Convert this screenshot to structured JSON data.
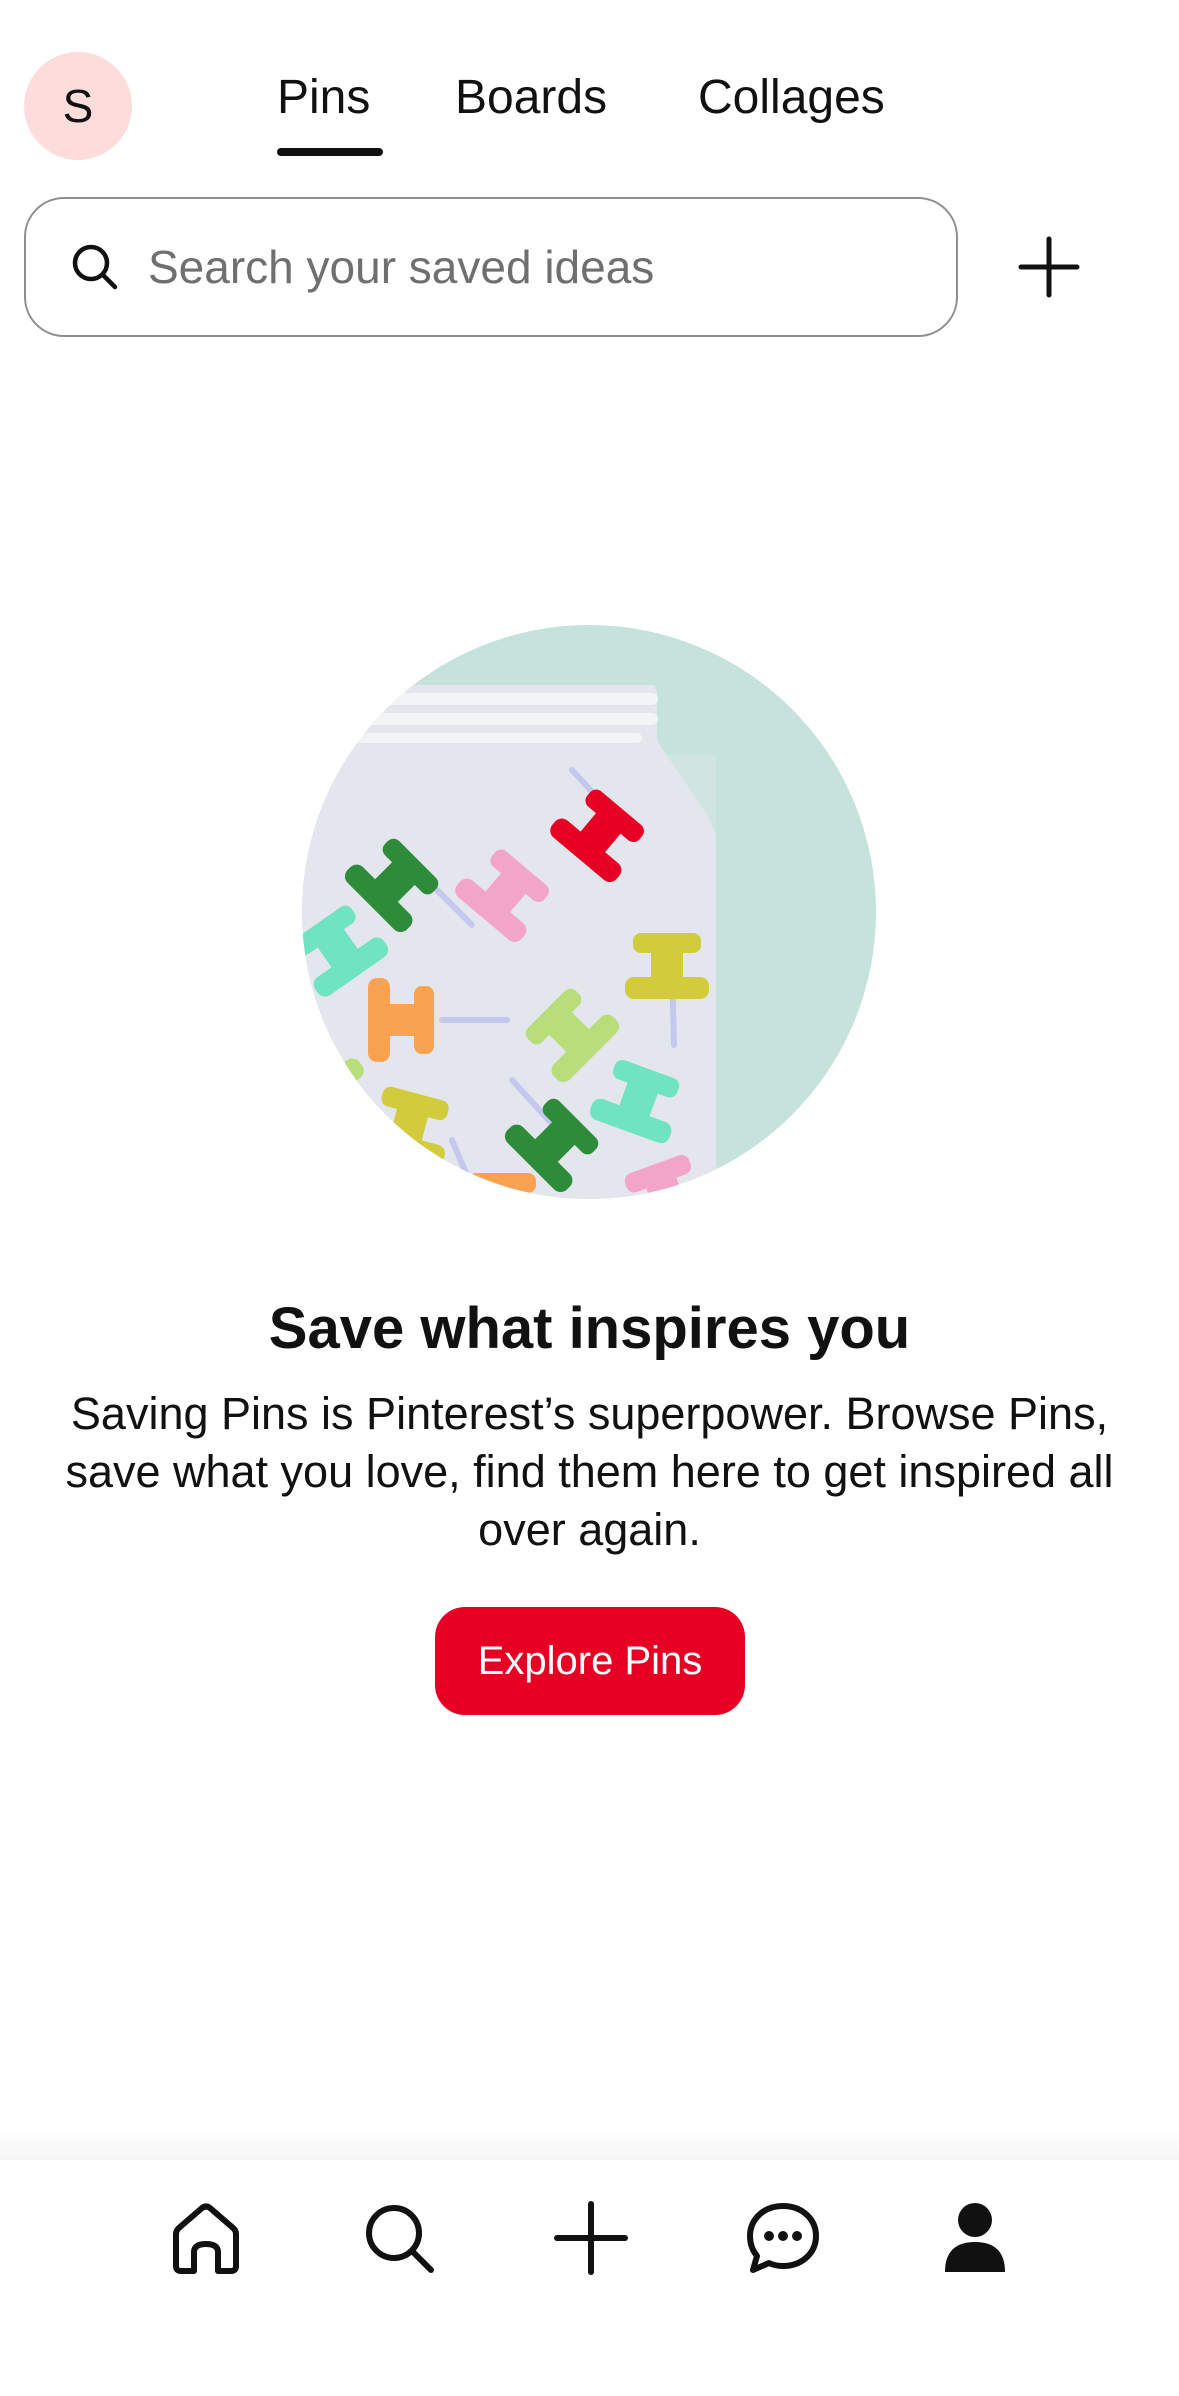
{
  "header": {
    "avatar_initial": "S",
    "tabs": [
      {
        "label": "Pins",
        "active": true
      },
      {
        "label": "Boards",
        "active": false
      },
      {
        "label": "Collages",
        "active": false
      }
    ]
  },
  "search": {
    "placeholder": "Search your saved ideas",
    "icon": "search-icon",
    "add_icon": "plus-icon"
  },
  "empty_state": {
    "title": "Save what inspires you",
    "description": "Saving Pins is Pinterest’s superpower. Browse Pins, save what you love, find them here to get inspired all over again.",
    "button_label": "Explore Pins",
    "illustration": "jar-of-pushpins"
  },
  "bottom_nav": {
    "items": [
      "home-icon",
      "search-icon",
      "create-icon",
      "messages-icon",
      "profile-icon"
    ],
    "active": "profile-icon"
  },
  "colors": {
    "accent": "#e60023",
    "avatar_bg": "#fddcdc",
    "text": "#111111"
  }
}
